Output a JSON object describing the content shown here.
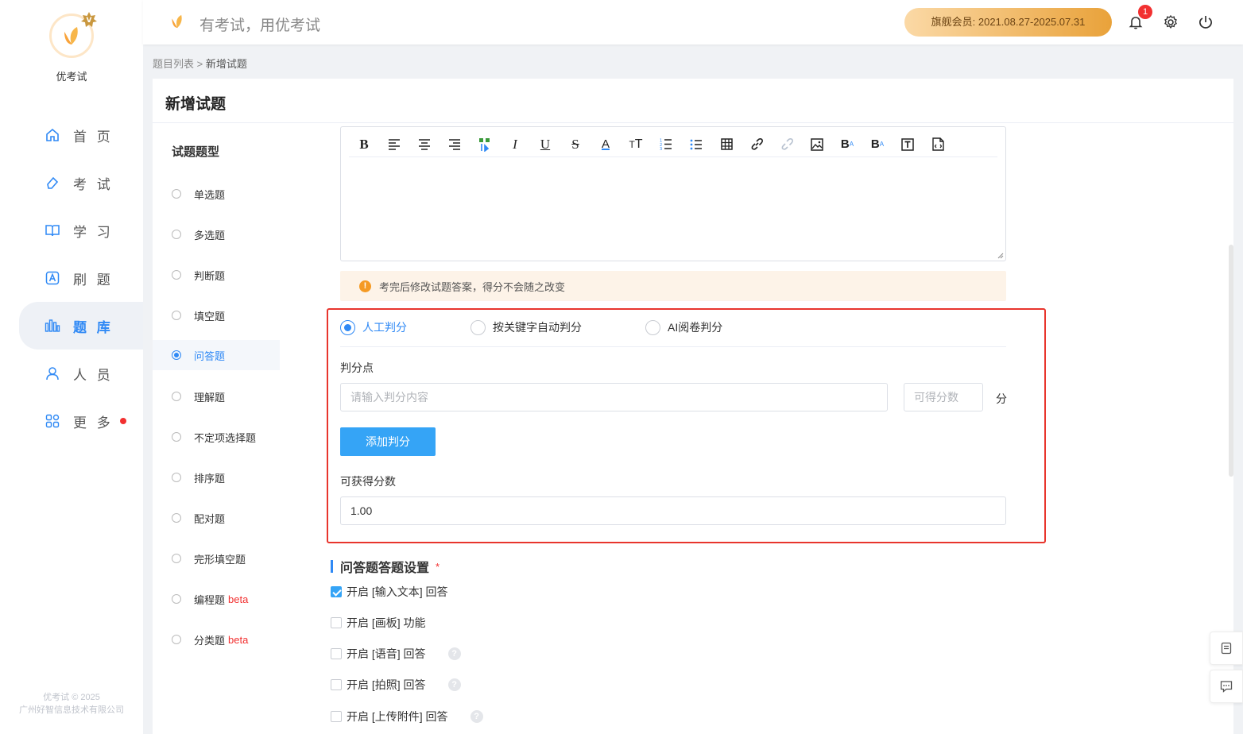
{
  "sidebar": {
    "brand": "优考试",
    "items": [
      {
        "label": "首 页",
        "icon": "home-icon"
      },
      {
        "label": "考 试",
        "icon": "eraser-icon"
      },
      {
        "label": "学 习",
        "icon": "book-icon"
      },
      {
        "label": "刷 题",
        "icon": "letter-a-icon"
      },
      {
        "label": "题 库",
        "icon": "bar-chart-icon"
      },
      {
        "label": "人 员",
        "icon": "user-icon"
      },
      {
        "label": "更 多",
        "icon": "apps-icon"
      }
    ],
    "active_index": 4,
    "copyright_line1": "优考试 © 2025",
    "copyright_line2": "广州好智信息技术有限公司"
  },
  "header": {
    "slogan": "有考试，用优考试",
    "vip_label": "旗舰会员:  2021.08.27-2025.07.31",
    "notification_count": "1"
  },
  "breadcrumb": {
    "parent": "题目列表",
    "separator": " > ",
    "current": "新增试题"
  },
  "page": {
    "title": "新增试题"
  },
  "question_types": {
    "title": "试题题型",
    "items": [
      {
        "label": "单选题"
      },
      {
        "label": "多选题"
      },
      {
        "label": "判断题"
      },
      {
        "label": "填空题"
      },
      {
        "label": "问答题"
      },
      {
        "label": "理解题"
      },
      {
        "label": "不定项选择题"
      },
      {
        "label": "排序题"
      },
      {
        "label": "配对题"
      },
      {
        "label": "完形填空题"
      },
      {
        "label": "编程题",
        "tag": "beta"
      },
      {
        "label": "分类题",
        "tag": "beta"
      }
    ],
    "selected": "问答题"
  },
  "editor": {
    "toolbar": [
      "bold",
      "align-left",
      "align-center",
      "align-right",
      "format-painter",
      "italic",
      "underline",
      "strikethrough",
      "font-color",
      "font-size",
      "ordered-list",
      "unordered-list",
      "table",
      "link",
      "unlink",
      "image",
      "superscript",
      "subscript",
      "text-box",
      "html-source"
    ]
  },
  "warning": {
    "text": "考完后修改试题答案，得分不会随之改变"
  },
  "grading": {
    "modes": [
      {
        "label": "人工判分",
        "checked": true
      },
      {
        "label": "按关键字自动判分",
        "checked": false
      },
      {
        "label": "AI阅卷判分",
        "checked": false
      }
    ],
    "points_label": "判分点",
    "points_placeholder": "请输入判分内容",
    "score_placeholder": "可得分数",
    "score_unit": "分",
    "add_button": "添加判分",
    "total_label": "可获得分数",
    "total_value": "1.00"
  },
  "answer_settings": {
    "title": "问答题答题设置",
    "required_mark": "*",
    "options": [
      {
        "label": "开启 [输入文本] 回答",
        "checked": true,
        "help": false
      },
      {
        "label": "开启 [画板] 功能",
        "checked": false,
        "help": false
      },
      {
        "label": "开启 [语音] 回答",
        "checked": false,
        "help": true
      },
      {
        "label": "开启 [拍照] 回答",
        "checked": false,
        "help": true
      },
      {
        "label": "开启 [上传附件] 回答",
        "checked": false,
        "help": true
      }
    ],
    "help_glyph": "?"
  },
  "colors": {
    "primary": "#2f89f5",
    "button": "#35a4f6",
    "highlight_border": "#e8352d",
    "warning_bg": "#fdf3e8",
    "beta": "#f23030"
  }
}
